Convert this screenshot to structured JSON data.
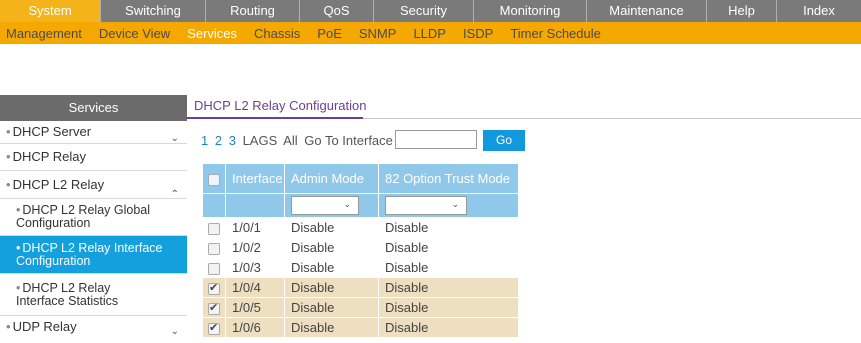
{
  "topnav": [
    "System",
    "Switching",
    "Routing",
    "QoS",
    "Security",
    "Monitoring",
    "Maintenance",
    "Help",
    "Index"
  ],
  "subnav": [
    "Management",
    "Device View",
    "Services",
    "Chassis",
    "PoE",
    "SNMP",
    "LLDP",
    "ISDP",
    "Timer Schedule"
  ],
  "sidebar": {
    "header": "Services",
    "items": [
      {
        "label": "DHCP Server"
      },
      {
        "label": "DHCP Relay"
      },
      {
        "label": "DHCP L2 Relay"
      },
      {
        "label": "DHCP L2 Relay Global Configuration"
      },
      {
        "label": "DHCP L2 Relay Interface Configuration"
      },
      {
        "label": "DHCP L2 Relay Interface Statistics"
      },
      {
        "label": "UDP Relay"
      }
    ]
  },
  "main": {
    "title": "DHCP L2 Relay Configuration",
    "filter_links": [
      "1",
      "2",
      "3",
      "LAGS",
      "All"
    ],
    "goto_label": "Go To Interface",
    "go_button": "Go",
    "columns": [
      "Interface",
      "Admin Mode",
      "82 Option Trust Mode"
    ],
    "rows": [
      {
        "interface": "1/0/1",
        "admin_mode": "Disable",
        "trust_mode": "Disable",
        "checked": false
      },
      {
        "interface": "1/0/2",
        "admin_mode": "Disable",
        "trust_mode": "Disable",
        "checked": false
      },
      {
        "interface": "1/0/3",
        "admin_mode": "Disable",
        "trust_mode": "Disable",
        "checked": false
      },
      {
        "interface": "1/0/4",
        "admin_mode": "Disable",
        "trust_mode": "Disable",
        "checked": true
      },
      {
        "interface": "1/0/5",
        "admin_mode": "Disable",
        "trust_mode": "Disable",
        "checked": true
      },
      {
        "interface": "1/0/6",
        "admin_mode": "Disable",
        "trust_mode": "Disable",
        "checked": true
      }
    ]
  },
  "colors": {
    "nav_active": "#f3b319",
    "subnav": "#f5a800",
    "sidebar_selected": "#13a0dd",
    "table_header": "#8fc8e8",
    "checked_row": "#efdfc1",
    "title": "#6d3f96"
  }
}
